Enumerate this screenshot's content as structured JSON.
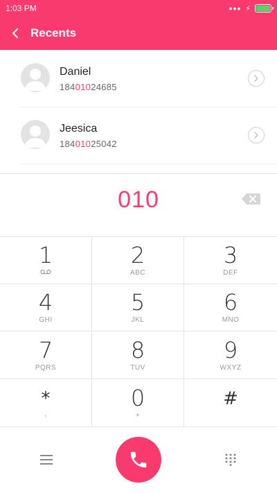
{
  "status_bar": {
    "time": "1:03 PM",
    "signal": "•••"
  },
  "header": {
    "title": "Recents"
  },
  "contacts": [
    {
      "name": "Daniel",
      "number_prefix": "184",
      "number_match": "010",
      "number_suffix": "24685"
    },
    {
      "name": "Jeesica",
      "number_prefix": "184",
      "number_match": "010",
      "number_suffix": "25042"
    }
  ],
  "dialer": {
    "input": "010"
  },
  "keys": [
    {
      "digit": "1",
      "letters": ""
    },
    {
      "digit": "2",
      "letters": "ABC"
    },
    {
      "digit": "3",
      "letters": "DEF"
    },
    {
      "digit": "4",
      "letters": "GHI"
    },
    {
      "digit": "5",
      "letters": "JKL"
    },
    {
      "digit": "6",
      "letters": "MNO"
    },
    {
      "digit": "7",
      "letters": "PQRS"
    },
    {
      "digit": "8",
      "letters": "TUV"
    },
    {
      "digit": "9",
      "letters": "WXYZ"
    },
    {
      "digit": "*",
      "letters": ","
    },
    {
      "digit": "0",
      "letters": "+"
    },
    {
      "digit": "#",
      "letters": ""
    }
  ],
  "colors": {
    "accent": "#f93a6e",
    "battery": "#4cd964"
  },
  "icons": [
    "back-icon",
    "voicemail-icon",
    "backspace-icon",
    "menu-icon",
    "phone-icon",
    "keypad-icon",
    "chevron-right-icon",
    "avatar-placeholder-icon",
    "battery-icon",
    "charging-icon"
  ]
}
